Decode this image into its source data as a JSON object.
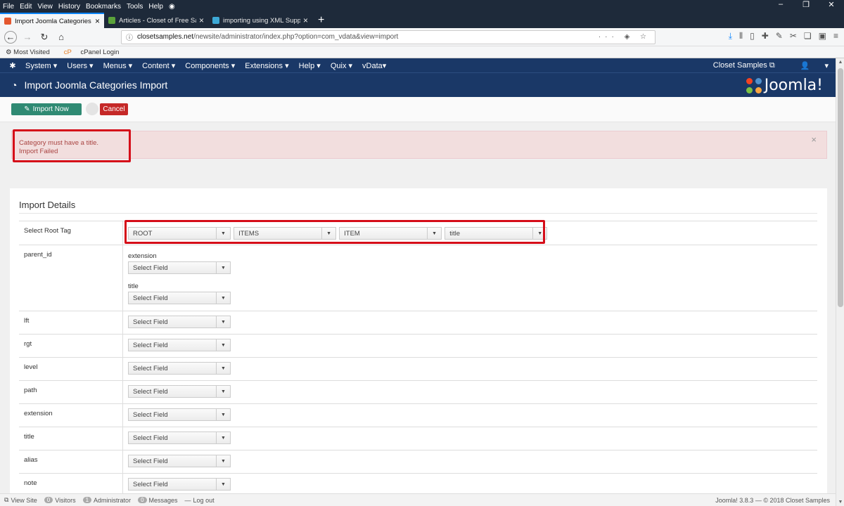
{
  "menubar": {
    "items": [
      "File",
      "Edit",
      "View",
      "History",
      "Bookmarks",
      "Tools",
      "Help"
    ]
  },
  "tabs": [
    {
      "title": "Import Joomla Categories Impo",
      "active": true
    },
    {
      "title": "Articles - Closet of Free Sampl",
      "active": false
    },
    {
      "title": "importing using XML Support",
      "active": false
    }
  ],
  "urlbar": {
    "host": "closetsamples.net",
    "path": "/newsite/administrator/index.php?option=com_vdata&view=import"
  },
  "bookmarks": [
    "Most Visited",
    "cPanel Login"
  ],
  "jnav": {
    "items": [
      "System ▾",
      "Users ▾",
      "Menus ▾",
      "Content ▾",
      "Components ▾",
      "Extensions ▾",
      "Help ▾",
      "Quix ▾",
      "vData▾"
    ],
    "site_link": "Closet Samples ⧉",
    "user": "▾"
  },
  "header": {
    "title": "Import Joomla Categories Import",
    "brand": "Joomla!"
  },
  "toolbar": {
    "import_label": "Import Now",
    "cancel_label": "Cancel"
  },
  "alert": {
    "line1": "Category must have a title.",
    "line2": "Import Failed",
    "close": "×"
  },
  "panel": {
    "title": "Import Details"
  },
  "root_tag": {
    "label": "Select Root Tag",
    "selects": [
      "ROOT",
      "ITEMS",
      "ITEM",
      "title"
    ]
  },
  "parent_id": {
    "label": "parent_id",
    "sub1": "extension",
    "sub2": "title",
    "placeholder": "Select Field"
  },
  "fields": [
    {
      "label": "lft",
      "value": "Select Field"
    },
    {
      "label": "rgt",
      "value": "Select Field"
    },
    {
      "label": "level",
      "value": "Select Field"
    },
    {
      "label": "path",
      "value": "Select Field"
    },
    {
      "label": "extension",
      "value": "Select Field"
    },
    {
      "label": "title",
      "value": "Select Field"
    },
    {
      "label": "alias",
      "value": "Select Field"
    },
    {
      "label": "note",
      "value": "Select Field"
    }
  ],
  "statusbar": {
    "view_site": "View Site",
    "visitors_count": "0",
    "visitors": "Visitors",
    "admin_count": "1",
    "admin": "Administrator",
    "messages_count": "0",
    "messages": "Messages",
    "logout": "Log out",
    "version": "Joomla! 3.8.3 — © 2018 Closet Samples"
  },
  "colors": {
    "joomla_blue": "#1a3867",
    "import_green": "#2f8a73",
    "cancel_red": "#c52827",
    "highlight_red": "#d50d19"
  }
}
